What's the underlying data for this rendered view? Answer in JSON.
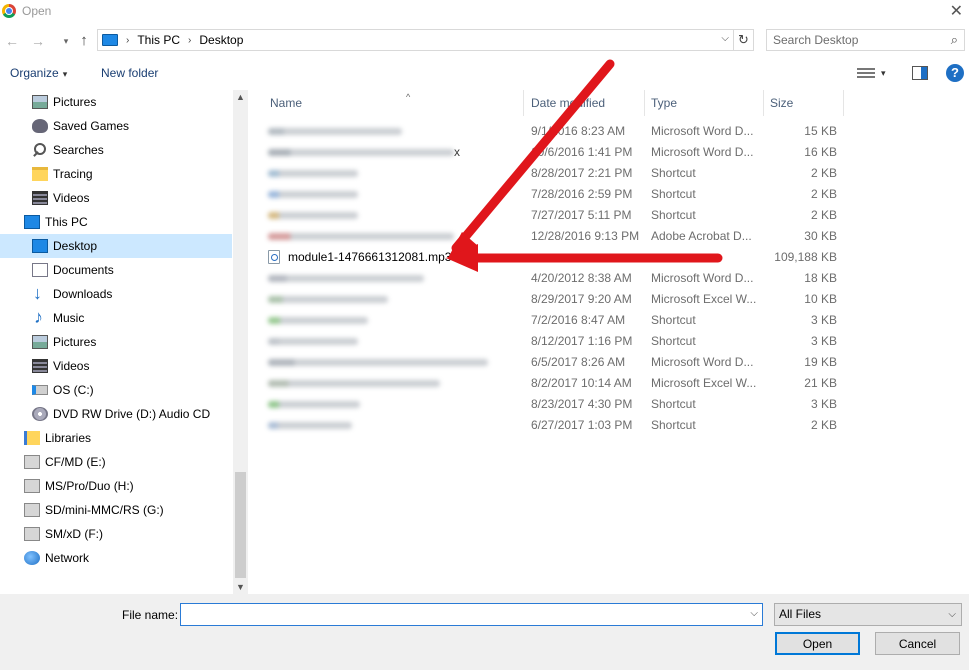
{
  "window": {
    "title": "Open",
    "close_glyph": "✕"
  },
  "nav_buttons": {
    "back": "←",
    "forward": "→",
    "recent": "▾",
    "up": "↑"
  },
  "address": {
    "crumbs": [
      "This PC",
      "Desktop"
    ],
    "separator": "›",
    "dropdown": "⌵",
    "refresh": "↻"
  },
  "search": {
    "placeholder": "Search Desktop",
    "value": "",
    "icon": "⌕"
  },
  "toolbar": {
    "organize": "Organize",
    "organize_caret": "▾",
    "new_folder": "New folder",
    "views_caret": "▾",
    "help": "?"
  },
  "navigation": [
    {
      "label": "Pictures",
      "icon": "pictures-icon",
      "indent": 2,
      "selected": false
    },
    {
      "label": "Saved Games",
      "icon": "saved-games-icon",
      "indent": 2,
      "selected": false
    },
    {
      "label": "Searches",
      "icon": "searches-icon",
      "indent": 2,
      "selected": false
    },
    {
      "label": "Tracing",
      "icon": "folder-icon",
      "indent": 2,
      "selected": false
    },
    {
      "label": "Videos",
      "icon": "videos-icon",
      "indent": 2,
      "selected": false
    },
    {
      "label": "This PC",
      "icon": "this-pc-icon",
      "indent": 1,
      "selected": false
    },
    {
      "label": "Desktop",
      "icon": "desktop-icon",
      "indent": 2,
      "selected": true
    },
    {
      "label": "Documents",
      "icon": "documents-icon",
      "indent": 2,
      "selected": false
    },
    {
      "label": "Downloads",
      "icon": "downloads-icon",
      "indent": 2,
      "selected": false
    },
    {
      "label": "Music",
      "icon": "music-icon",
      "indent": 2,
      "selected": false
    },
    {
      "label": "Pictures",
      "icon": "pictures-icon",
      "indent": 2,
      "selected": false
    },
    {
      "label": "Videos",
      "icon": "videos-icon",
      "indent": 2,
      "selected": false
    },
    {
      "label": "OS (C:)",
      "icon": "os-drive-icon",
      "indent": 2,
      "selected": false
    },
    {
      "label": "DVD RW Drive (D:) Audio CD",
      "icon": "dvd-drive-icon",
      "indent": 2,
      "selected": false
    },
    {
      "label": "Libraries",
      "icon": "libraries-icon",
      "indent": 1,
      "selected": false
    },
    {
      "label": "CF/MD (E:)",
      "icon": "removable-drive-icon",
      "indent": 1,
      "selected": false
    },
    {
      "label": "MS/Pro/Duo (H:)",
      "icon": "removable-drive-icon",
      "indent": 1,
      "selected": false
    },
    {
      "label": "SD/mini-MMC/RS (G:)",
      "icon": "removable-drive-icon",
      "indent": 1,
      "selected": false
    },
    {
      "label": "SM/xD (F:)",
      "icon": "removable-drive-icon",
      "indent": 1,
      "selected": false
    },
    {
      "label": "Network",
      "icon": "network-icon",
      "indent": 1,
      "selected": false
    }
  ],
  "nav_scroll": {
    "up": "▲",
    "down": "▼"
  },
  "columns": {
    "name": "Name",
    "date": "Date modified",
    "type": "Type",
    "size": "Size",
    "sort_arrow": "^"
  },
  "files": [
    {
      "name": "",
      "blurred": true,
      "date": "9/1/2016 8:23 AM",
      "type": "Microsoft Word D...",
      "size": "15 KB",
      "tint": "#9aa4ad"
    },
    {
      "name": "x",
      "blurred": true,
      "date": "10/6/2016 1:41 PM",
      "type": "Microsoft Word D...",
      "size": "16 KB",
      "tint": "#8d96a0"
    },
    {
      "name": "",
      "blurred": true,
      "date": "8/28/2017 2:21 PM",
      "type": "Shortcut",
      "size": "2 KB",
      "tint": "#86a8c4"
    },
    {
      "name": "",
      "blurred": true,
      "date": "7/28/2016 2:59 PM",
      "type": "Shortcut",
      "size": "2 KB",
      "tint": "#7aa0d0"
    },
    {
      "name": "",
      "blurred": true,
      "date": "7/27/2017 5:11 PM",
      "type": "Shortcut",
      "size": "2 KB",
      "tint": "#c7a35a"
    },
    {
      "name": "",
      "blurred": true,
      "date": "12/28/2016 9:13 PM",
      "type": "Adobe Acrobat D...",
      "size": "30 KB",
      "tint": "#c77b7b"
    },
    {
      "name": "module1-1476661312081.mp3",
      "blurred": false,
      "date": "",
      "type": "",
      "size": "109,188 KB",
      "tint": ""
    },
    {
      "name": "",
      "blurred": true,
      "date": "4/20/2012 8:38 AM",
      "type": "Microsoft Word D...",
      "size": "18 KB",
      "tint": "#9aa0ab"
    },
    {
      "name": "",
      "blurred": true,
      "date": "8/29/2017 9:20 AM",
      "type": "Microsoft Excel W...",
      "size": "10 KB",
      "tint": "#8fae8f"
    },
    {
      "name": "",
      "blurred": true,
      "date": "7/2/2016 8:47 AM",
      "type": "Shortcut",
      "size": "3 KB",
      "tint": "#77b86f"
    },
    {
      "name": "",
      "blurred": true,
      "date": "8/12/2017 1:16 PM",
      "type": "Shortcut",
      "size": "3 KB",
      "tint": "#a9b0b8"
    },
    {
      "name": "",
      "blurred": true,
      "date": "6/5/2017 8:26 AM",
      "type": "Microsoft Word D...",
      "size": "19 KB",
      "tint": "#949ca6"
    },
    {
      "name": "",
      "blurred": true,
      "date": "8/2/2017 10:14 AM",
      "type": "Microsoft Excel W...",
      "size": "21 KB",
      "tint": "#9aa89a"
    },
    {
      "name": "",
      "blurred": true,
      "date": "8/23/2017 4:30 PM",
      "type": "Shortcut",
      "size": "3 KB",
      "tint": "#6fb56a"
    },
    {
      "name": "",
      "blurred": true,
      "date": "6/27/2017 1:03 PM",
      "type": "Shortcut",
      "size": "2 KB",
      "tint": "#8fa8c8"
    }
  ],
  "bottom": {
    "file_name_label": "File name:",
    "file_name_value": "",
    "file_name_dropdown": "⌵",
    "filter": "All Files",
    "filter_dropdown": "⌵",
    "open_button": "Open",
    "cancel_button": "Cancel"
  },
  "colors": {
    "accent": "#0078d7",
    "selection": "#cce8ff",
    "arrow": "#e0161b"
  }
}
